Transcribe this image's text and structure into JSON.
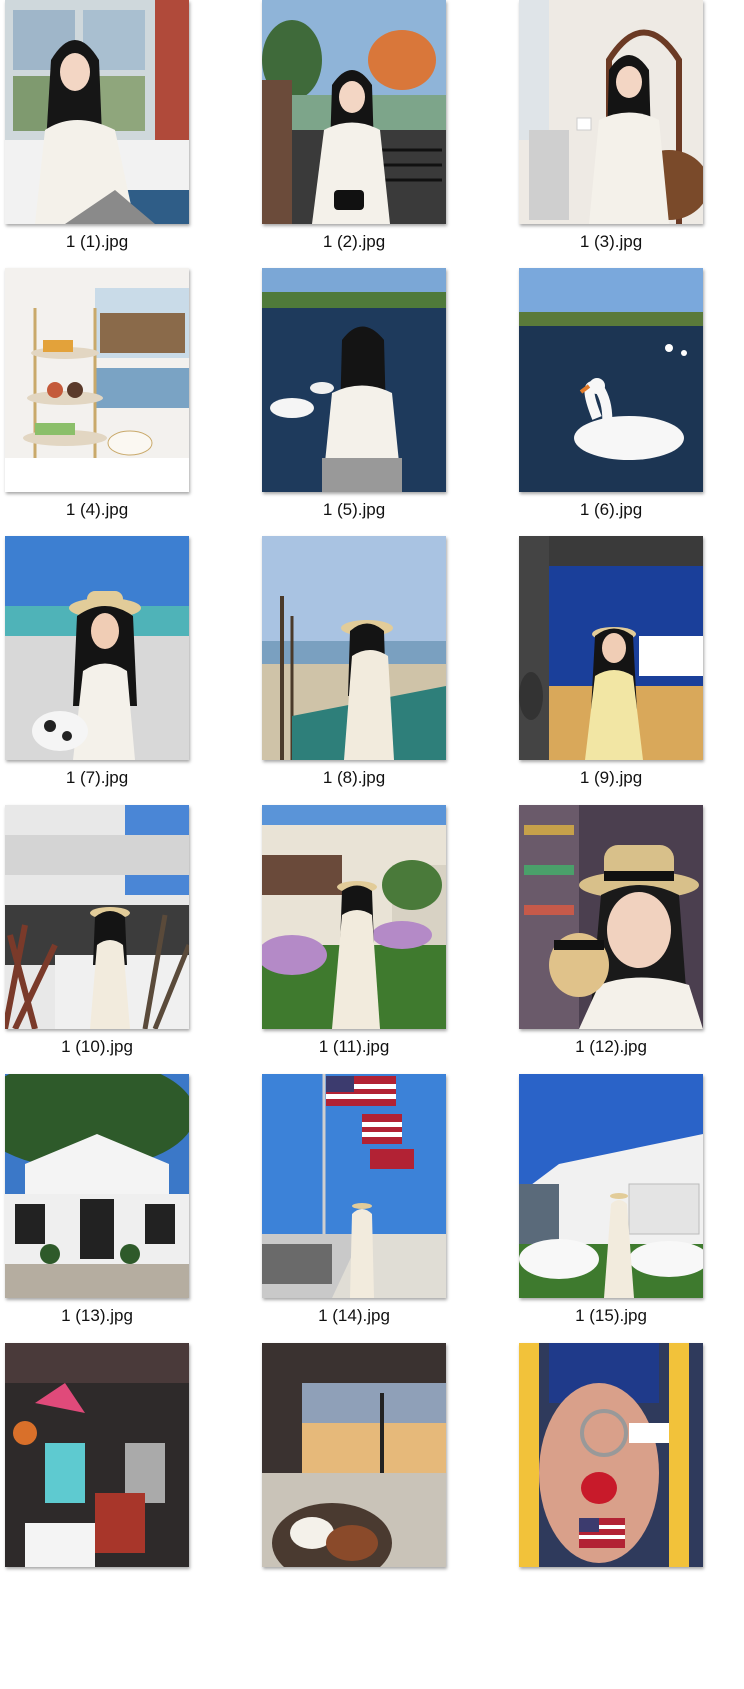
{
  "files": [
    {
      "name": "1 (1).jpg",
      "scene": "window-portrait"
    },
    {
      "name": "1 (2).jpg",
      "scene": "balcony-autumn"
    },
    {
      "name": "1 (3).jpg",
      "scene": "tea-room-portrait"
    },
    {
      "name": "1 (4).jpg",
      "scene": "afternoon-tea"
    },
    {
      "name": "1 (5).jpg",
      "scene": "lake-swans-portrait"
    },
    {
      "name": "1 (6).jpg",
      "scene": "swan-lake"
    },
    {
      "name": "1 (7).jpg",
      "scene": "pier-hat"
    },
    {
      "name": "1 (8).jpg",
      "scene": "beach-palms"
    },
    {
      "name": "1 (9).jpg",
      "scene": "patio-night"
    },
    {
      "name": "1 (10).jpg",
      "scene": "building-plants"
    },
    {
      "name": "1 (11).jpg",
      "scene": "garden-hydrangea"
    },
    {
      "name": "1 (12).jpg",
      "scene": "shop-mug-selfie"
    },
    {
      "name": "1 (13).jpg",
      "scene": "white-house-tree"
    },
    {
      "name": "1 (14).jpg",
      "scene": "flags-street"
    },
    {
      "name": "1 (15).jpg",
      "scene": "house-flowers"
    },
    {
      "name": "",
      "scene": "cocktails"
    },
    {
      "name": "",
      "scene": "sunset-dinner"
    },
    {
      "name": "",
      "scene": "flag-keychain"
    }
  ]
}
